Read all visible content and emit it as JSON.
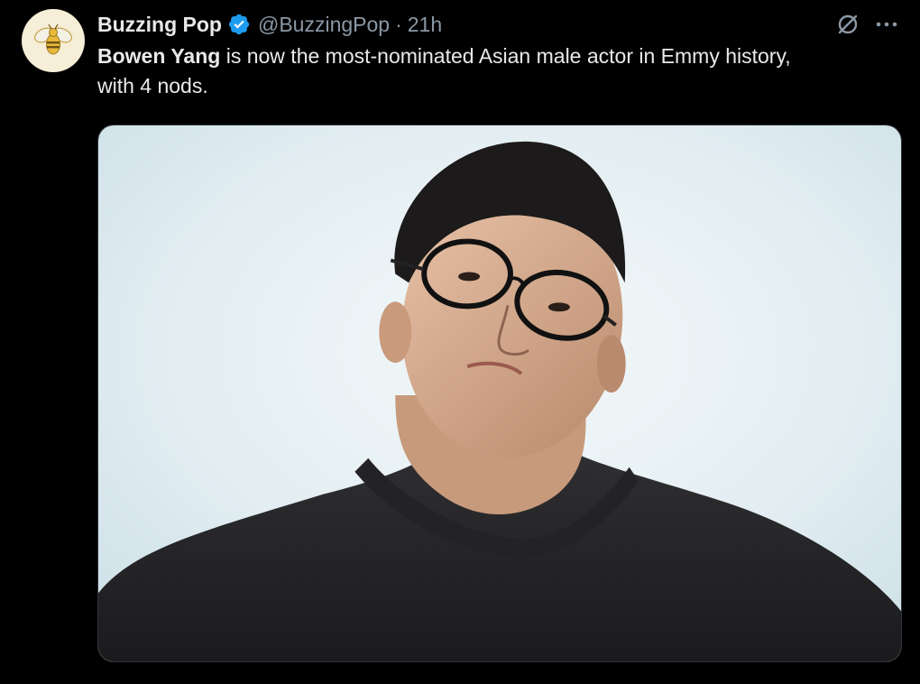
{
  "tweet": {
    "author": {
      "display_name": "Buzzing Pop",
      "handle": "@BuzzingPop",
      "avatar_icon": "bee-icon",
      "verified": true,
      "verified_color": "#1d9bf0"
    },
    "separator": "·",
    "timestamp": "21h",
    "text": {
      "mention": "Bowen Yang",
      "rest_line1": " is now the most-nominated Asian male actor in Emmy history,",
      "rest_line2": "with 4 nods."
    },
    "actions": {
      "grok_icon": "grok-icon",
      "more_icon": "more-icon"
    },
    "media": {
      "type": "photo",
      "background_color": "#dde9ee"
    }
  }
}
